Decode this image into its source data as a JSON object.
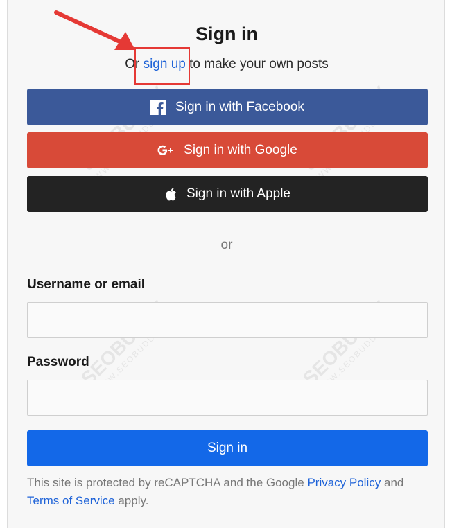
{
  "header": {
    "title": "Sign in",
    "subtitle_prefix": "Or",
    "signup_link": "sign up",
    "subtitle_suffix": "to make your own posts"
  },
  "social": {
    "facebook_label": "Sign in with Facebook",
    "google_label": "Sign in with Google",
    "apple_label": "Sign in with Apple"
  },
  "divider": {
    "text": "or"
  },
  "form": {
    "username_label": "Username or email",
    "username_value": "",
    "password_label": "Password",
    "password_value": "",
    "submit_label": "Sign in"
  },
  "legal": {
    "prefix": "This site is protected by reCAPTCHA and the Google",
    "privacy_link": "Privacy Policy",
    "middle": "and",
    "terms_link": "Terms of Service",
    "suffix": "apply."
  },
  "watermark": {
    "brand": "SEOBUDDY",
    "domain": "WWW.SEOBUDDY.COM"
  },
  "colors": {
    "facebook": "#3b5999",
    "google": "#d84a38",
    "apple": "#232323",
    "primary": "#1368e8",
    "link": "#1f63d8",
    "annotation": "#e53935"
  },
  "icons": [
    "facebook-icon",
    "google-plus-icon",
    "apple-icon",
    "annotation-arrow"
  ]
}
